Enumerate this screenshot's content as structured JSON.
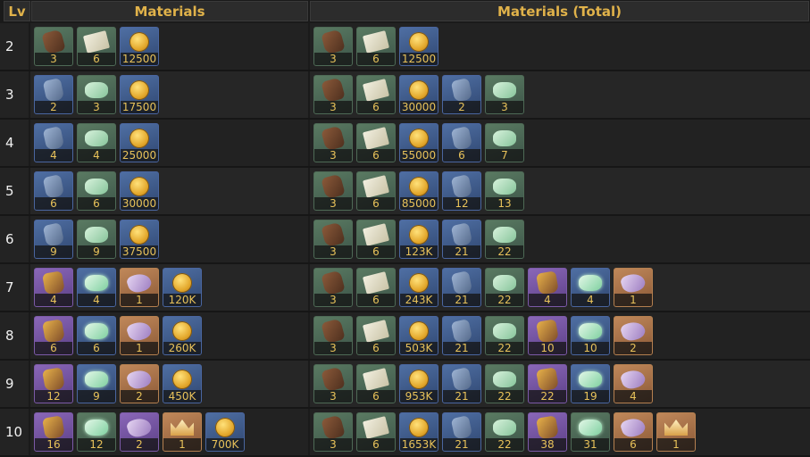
{
  "header": {
    "lv_label": "Lv",
    "materials_label": "Materials",
    "total_label": "Materials (Total)"
  },
  "icon_styles": {
    "brown-ore": {
      "rarity": "r-green",
      "glyph": "g-ore-brown"
    },
    "paper": {
      "rarity": "r-green",
      "glyph": "g-paper"
    },
    "mora": {
      "rarity": "r-blue",
      "glyph": "g-coin"
    },
    "blue-ore": {
      "rarity": "r-blue",
      "glyph": "g-ore-blue"
    },
    "jade": {
      "rarity": "r-green",
      "glyph": "g-jade"
    },
    "gold-ore": {
      "rarity": "r-purple",
      "glyph": "g-ore-gold"
    },
    "jade-shine": {
      "rarity": "r-blue",
      "glyph": "g-jade-shine"
    },
    "cloth": {
      "rarity": "r-gold",
      "glyph": "g-cloth"
    },
    "cloth-purple": {
      "rarity": "r-purple",
      "glyph": "g-cloth"
    },
    "jade-green": {
      "rarity": "r-green",
      "glyph": "g-jade-shine"
    },
    "crown": {
      "rarity": "r-gold",
      "glyph": "g-crown"
    }
  },
  "rows": [
    {
      "lv": "2",
      "materials": [
        {
          "icon": "brown-ore",
          "qty": "3"
        },
        {
          "icon": "paper",
          "qty": "6"
        },
        {
          "icon": "mora",
          "qty": "12500"
        }
      ],
      "total": [
        {
          "icon": "brown-ore",
          "qty": "3"
        },
        {
          "icon": "paper",
          "qty": "6"
        },
        {
          "icon": "mora",
          "qty": "12500"
        }
      ]
    },
    {
      "lv": "3",
      "materials": [
        {
          "icon": "blue-ore",
          "qty": "2"
        },
        {
          "icon": "jade",
          "qty": "3"
        },
        {
          "icon": "mora",
          "qty": "17500"
        }
      ],
      "total": [
        {
          "icon": "brown-ore",
          "qty": "3"
        },
        {
          "icon": "paper",
          "qty": "6"
        },
        {
          "icon": "mora",
          "qty": "30000"
        },
        {
          "icon": "blue-ore",
          "qty": "2"
        },
        {
          "icon": "jade",
          "qty": "3"
        }
      ]
    },
    {
      "lv": "4",
      "materials": [
        {
          "icon": "blue-ore",
          "qty": "4"
        },
        {
          "icon": "jade",
          "qty": "4"
        },
        {
          "icon": "mora",
          "qty": "25000"
        }
      ],
      "total": [
        {
          "icon": "brown-ore",
          "qty": "3"
        },
        {
          "icon": "paper",
          "qty": "6"
        },
        {
          "icon": "mora",
          "qty": "55000"
        },
        {
          "icon": "blue-ore",
          "qty": "6"
        },
        {
          "icon": "jade",
          "qty": "7"
        }
      ]
    },
    {
      "lv": "5",
      "materials": [
        {
          "icon": "blue-ore",
          "qty": "6"
        },
        {
          "icon": "jade",
          "qty": "6"
        },
        {
          "icon": "mora",
          "qty": "30000"
        }
      ],
      "total": [
        {
          "icon": "brown-ore",
          "qty": "3"
        },
        {
          "icon": "paper",
          "qty": "6"
        },
        {
          "icon": "mora",
          "qty": "85000"
        },
        {
          "icon": "blue-ore",
          "qty": "12"
        },
        {
          "icon": "jade",
          "qty": "13"
        }
      ]
    },
    {
      "lv": "6",
      "materials": [
        {
          "icon": "blue-ore",
          "qty": "9"
        },
        {
          "icon": "jade",
          "qty": "9"
        },
        {
          "icon": "mora",
          "qty": "37500"
        }
      ],
      "total": [
        {
          "icon": "brown-ore",
          "qty": "3"
        },
        {
          "icon": "paper",
          "qty": "6"
        },
        {
          "icon": "mora",
          "qty": "123K"
        },
        {
          "icon": "blue-ore",
          "qty": "21"
        },
        {
          "icon": "jade",
          "qty": "22"
        }
      ]
    },
    {
      "lv": "7",
      "materials": [
        {
          "icon": "gold-ore",
          "qty": "4"
        },
        {
          "icon": "jade-shine",
          "qty": "4"
        },
        {
          "icon": "cloth",
          "qty": "1"
        },
        {
          "icon": "mora",
          "qty": "120K"
        }
      ],
      "total": [
        {
          "icon": "brown-ore",
          "qty": "3"
        },
        {
          "icon": "paper",
          "qty": "6"
        },
        {
          "icon": "mora",
          "qty": "243K"
        },
        {
          "icon": "blue-ore",
          "qty": "21"
        },
        {
          "icon": "jade",
          "qty": "22"
        },
        {
          "icon": "gold-ore",
          "qty": "4"
        },
        {
          "icon": "jade-shine",
          "qty": "4"
        },
        {
          "icon": "cloth",
          "qty": "1"
        }
      ]
    },
    {
      "lv": "8",
      "materials": [
        {
          "icon": "gold-ore",
          "qty": "6"
        },
        {
          "icon": "jade-shine",
          "qty": "6"
        },
        {
          "icon": "cloth",
          "qty": "1"
        },
        {
          "icon": "mora",
          "qty": "260K"
        }
      ],
      "total": [
        {
          "icon": "brown-ore",
          "qty": "3"
        },
        {
          "icon": "paper",
          "qty": "6"
        },
        {
          "icon": "mora",
          "qty": "503K"
        },
        {
          "icon": "blue-ore",
          "qty": "21"
        },
        {
          "icon": "jade",
          "qty": "22"
        },
        {
          "icon": "gold-ore",
          "qty": "10"
        },
        {
          "icon": "jade-shine",
          "qty": "10"
        },
        {
          "icon": "cloth",
          "qty": "2"
        }
      ]
    },
    {
      "lv": "9",
      "materials": [
        {
          "icon": "gold-ore",
          "qty": "12"
        },
        {
          "icon": "jade-shine",
          "qty": "9"
        },
        {
          "icon": "cloth",
          "qty": "2"
        },
        {
          "icon": "mora",
          "qty": "450K"
        }
      ],
      "total": [
        {
          "icon": "brown-ore",
          "qty": "3"
        },
        {
          "icon": "paper",
          "qty": "6"
        },
        {
          "icon": "mora",
          "qty": "953K"
        },
        {
          "icon": "blue-ore",
          "qty": "21"
        },
        {
          "icon": "jade",
          "qty": "22"
        },
        {
          "icon": "gold-ore",
          "qty": "22"
        },
        {
          "icon": "jade-shine",
          "qty": "19"
        },
        {
          "icon": "cloth",
          "qty": "4"
        }
      ]
    },
    {
      "lv": "10",
      "materials": [
        {
          "icon": "gold-ore",
          "qty": "16"
        },
        {
          "icon": "jade-green",
          "qty": "12"
        },
        {
          "icon": "cloth-purple",
          "qty": "2"
        },
        {
          "icon": "crown",
          "qty": "1"
        },
        {
          "icon": "mora",
          "qty": "700K"
        }
      ],
      "total": [
        {
          "icon": "brown-ore",
          "qty": "3"
        },
        {
          "icon": "paper",
          "qty": "6"
        },
        {
          "icon": "mora",
          "qty": "1653K"
        },
        {
          "icon": "blue-ore",
          "qty": "21"
        },
        {
          "icon": "jade",
          "qty": "22"
        },
        {
          "icon": "gold-ore",
          "qty": "38"
        },
        {
          "icon": "jade-green",
          "qty": "31"
        },
        {
          "icon": "cloth",
          "qty": "6"
        },
        {
          "icon": "crown",
          "qty": "1"
        }
      ]
    }
  ]
}
